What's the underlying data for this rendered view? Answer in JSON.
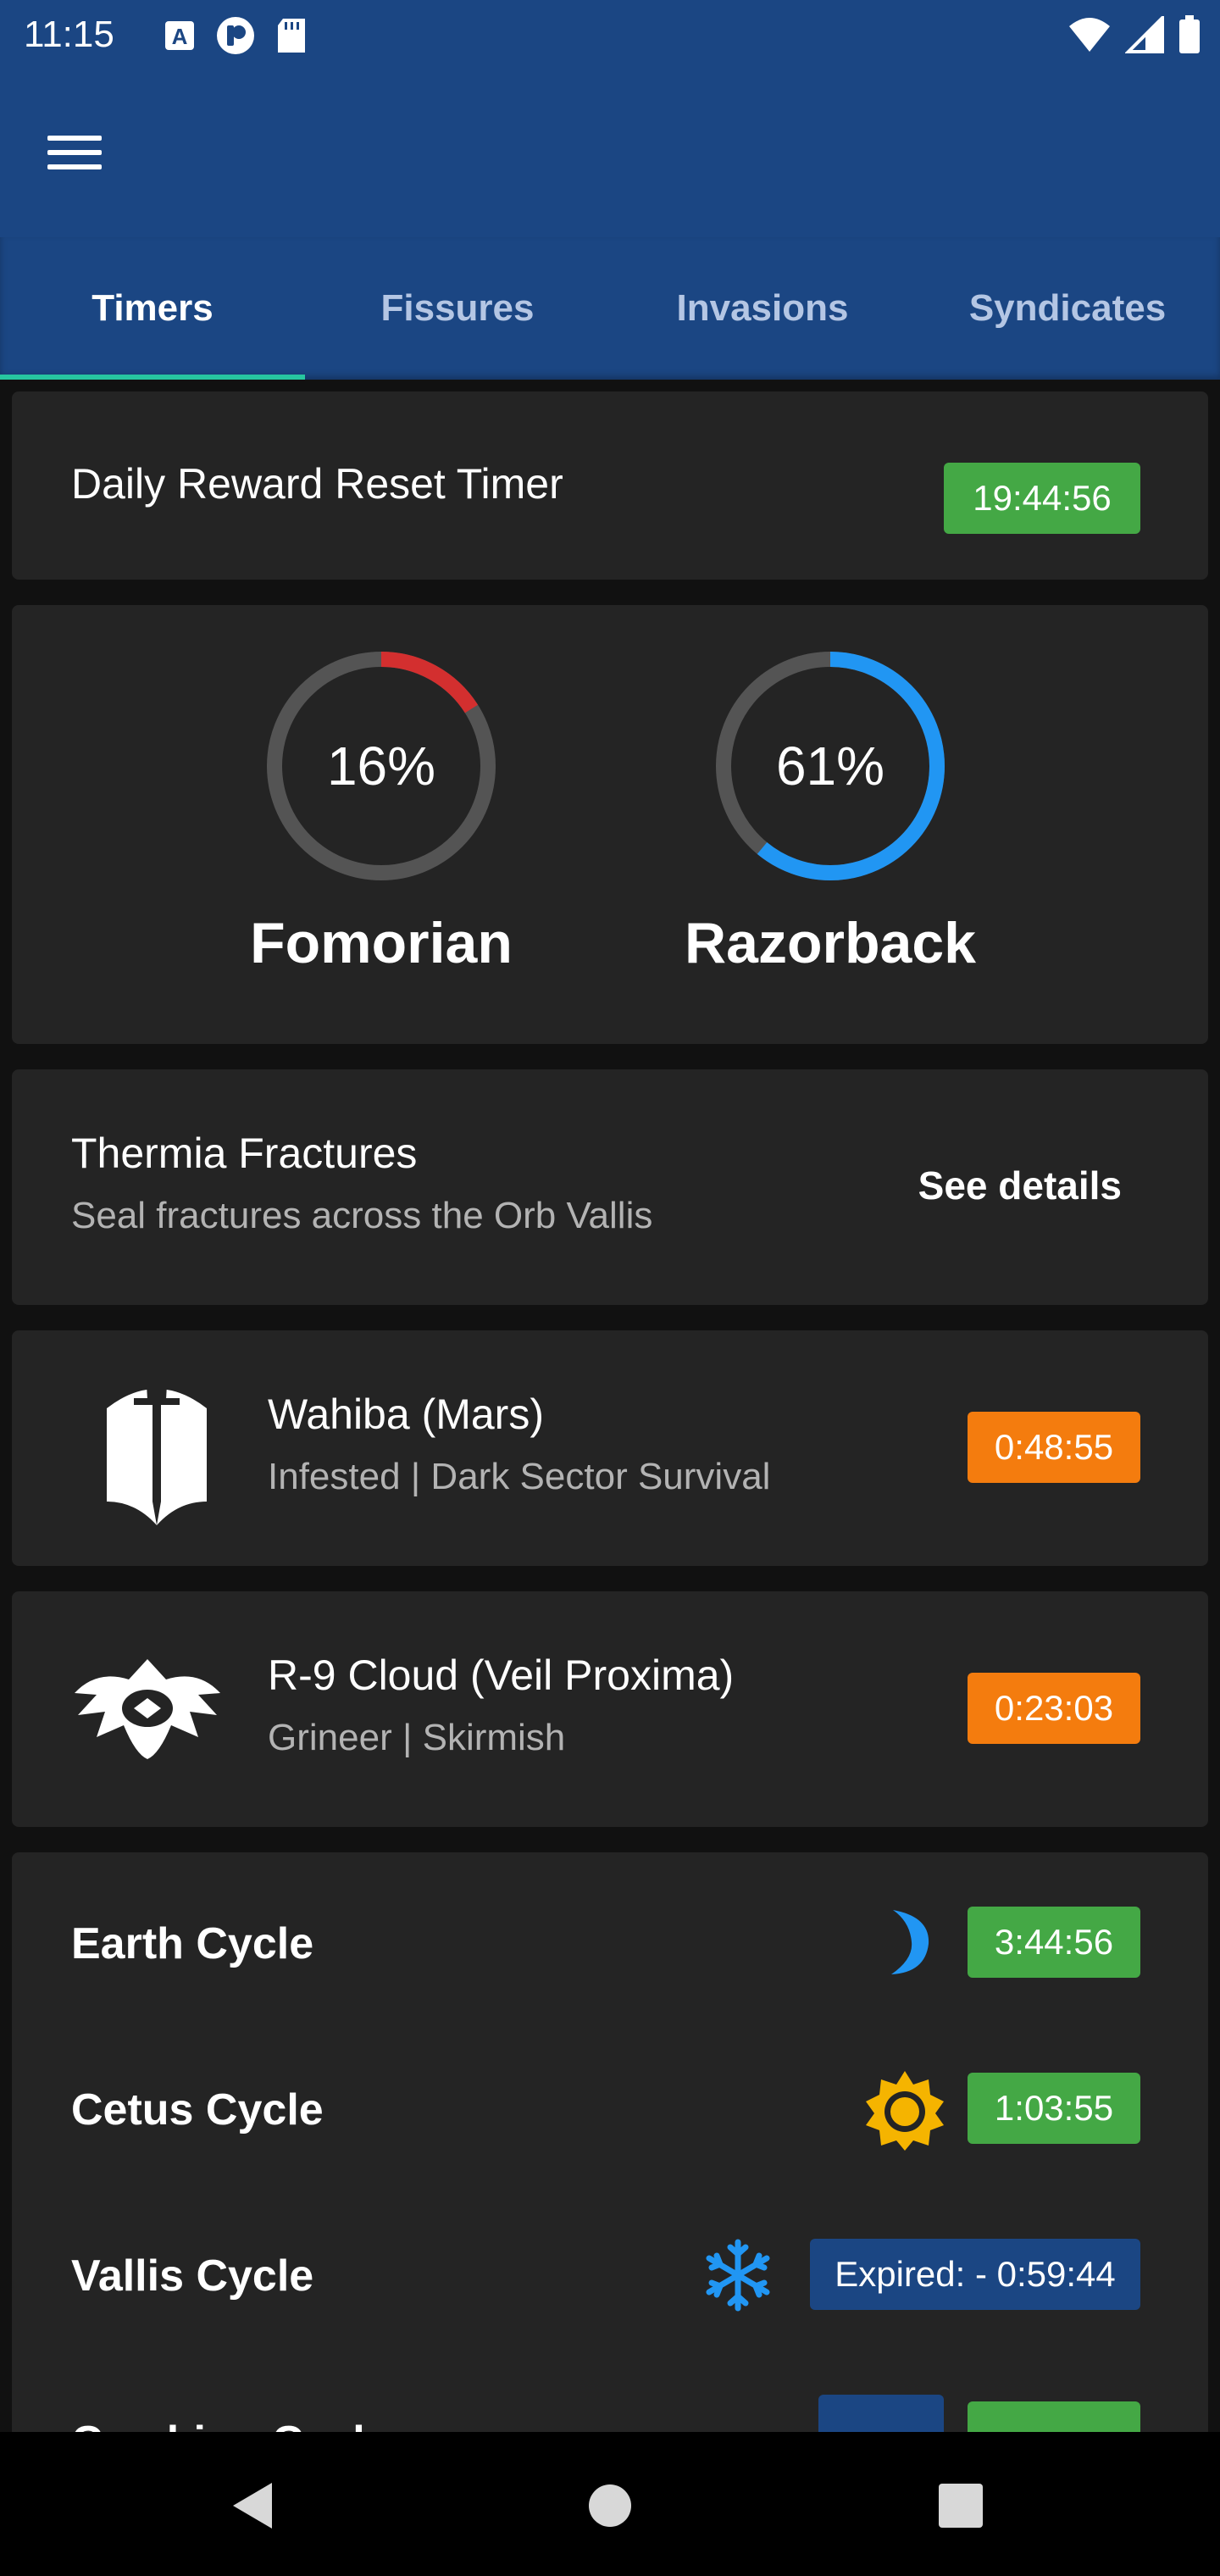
{
  "status_bar": {
    "time": "11:15",
    "left_icons": [
      "a-notification-icon",
      "pocket-casts-icon",
      "sd-card-icon"
    ],
    "right_icons": [
      "wifi-icon",
      "signal-icon",
      "battery-icon"
    ]
  },
  "app_bar": {
    "menu_icon": "hamburger-menu-icon"
  },
  "tabs": [
    {
      "label": "Timers",
      "active": true
    },
    {
      "label": "Fissures",
      "active": false
    },
    {
      "label": "Invasions",
      "active": false
    },
    {
      "label": "Syndicates",
      "active": false
    }
  ],
  "daily_reset": {
    "title": "Daily Reward Reset Timer",
    "timer": "19:44:56",
    "color": "#44a845"
  },
  "construction": {
    "items": [
      {
        "name": "Fomorian",
        "percent_label": "16%",
        "percent": 16,
        "color": "#d32f2f"
      },
      {
        "name": "Razorback",
        "percent_label": "61%",
        "percent": 61,
        "color": "#2196f3"
      }
    ],
    "track_color": "#545454"
  },
  "event": {
    "title": "Thermia Fractures",
    "subtitle": "Seal fractures across the Orb Vallis",
    "action": "See details"
  },
  "missions": [
    {
      "icon": "infested-sword-shield-icon",
      "title": "Wahiba (Mars)",
      "subtitle": "Infested | Dark Sector Survival",
      "timer": "0:48:55",
      "color": "#f47c0e"
    },
    {
      "icon": "grineer-emblem-icon",
      "title": "R-9 Cloud (Veil Proxima)",
      "subtitle": "Grineer | Skirmish",
      "timer": "0:23:03",
      "color": "#f47c0e"
    }
  ],
  "cycles": [
    {
      "name": "Earth Cycle",
      "icon": "moon-icon",
      "timer": "3:44:56",
      "color": "#44a845"
    },
    {
      "name": "Cetus Cycle",
      "icon": "sun-icon",
      "timer": "1:03:55",
      "color": "#44a845"
    },
    {
      "name": "Vallis Cycle",
      "icon": "snowflake-icon",
      "timer": "Expired: - 0:59:44",
      "color": "#1b4683"
    },
    {
      "name": "Cambion Cycle",
      "icon": "cambion-icon",
      "timer": "",
      "color": "#44a845"
    }
  ],
  "nav_bar": {
    "buttons": [
      "back-icon",
      "home-icon",
      "recents-icon"
    ]
  }
}
